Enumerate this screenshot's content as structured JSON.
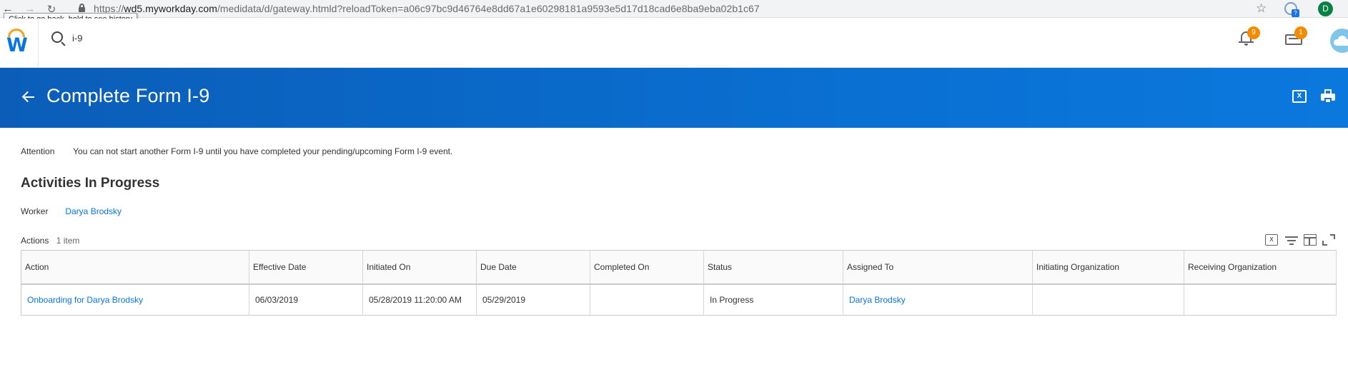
{
  "browser": {
    "url_scheme": "https://",
    "url_host": "wd5.myworkday.com",
    "url_path": "/medidata/d/gateway.htmld?reloadToken=a06c97bc9d46764e8dd67a1e60298181a9593e5d17d18cad6e8ba9eba02b1c67",
    "tooltip": "Click to go back, hold to see history",
    "profile_initial": "D",
    "back_glyph": "←",
    "forward_glyph": "→",
    "reload_glyph": "↻",
    "star_glyph": "☆",
    "ext_mini": "?"
  },
  "topbar": {
    "search_value": "i-9",
    "notifications_count": "9",
    "inbox_count": "1",
    "logo_letter": "W"
  },
  "header": {
    "title": "Complete Form I-9",
    "excel_glyph": "X"
  },
  "attention": {
    "label": "Attention",
    "message": "You can not start another Form I-9 until you have completed your pending/upcoming Form I-9 event."
  },
  "section": {
    "title": "Activities In Progress"
  },
  "worker": {
    "label": "Worker",
    "name": "Darya Brodsky"
  },
  "actions": {
    "label": "Actions",
    "count": "1 item",
    "excel_glyph": "X"
  },
  "table": {
    "columns": [
      "Action",
      "Effective Date",
      "Initiated On",
      "Due Date",
      "Completed On",
      "Status",
      "Assigned To",
      "Initiating Organization",
      "Receiving Organization"
    ],
    "rows": [
      {
        "action": "Onboarding for Darya Brodsky",
        "effective_date": "06/03/2019",
        "initiated_on": "05/28/2019 11:20:00 AM",
        "due_date": "05/29/2019",
        "completed_on": "",
        "status": "In Progress",
        "assigned_to": "Darya Brodsky",
        "initiating_org": "",
        "receiving_org": ""
      }
    ]
  },
  "colors": {
    "header_blue": "#0a6fd1",
    "link_blue": "#0875e1",
    "badge_orange": "#f38b00"
  }
}
